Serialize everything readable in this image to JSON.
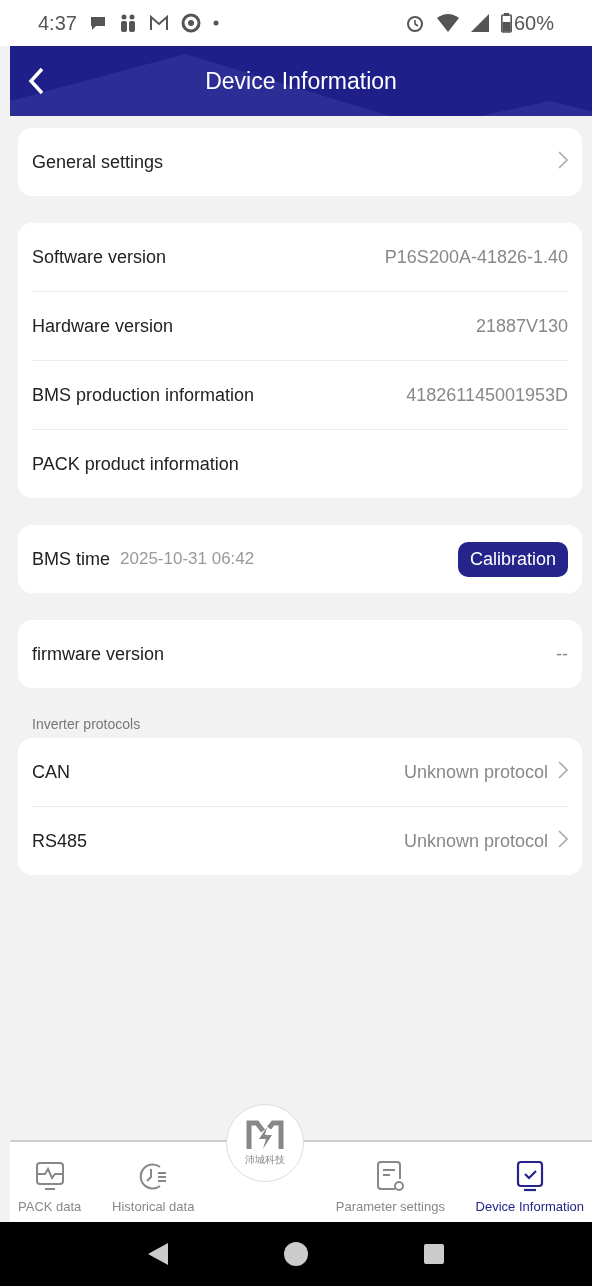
{
  "status_bar": {
    "time": "4:37",
    "battery": "60%"
  },
  "header": {
    "title": "Device Information"
  },
  "general": {
    "label": "General settings"
  },
  "versions": [
    {
      "label": "Software version",
      "value": "P16S200A-41826-1.40"
    },
    {
      "label": "Hardware version",
      "value": "21887V130"
    },
    {
      "label": "BMS production information",
      "value": "418261145001953D"
    },
    {
      "label": "PACK product information"
    }
  ],
  "bms_time": {
    "label": "BMS time",
    "value": "2025-10-31 06:42",
    "button": "Calibration"
  },
  "firmware": {
    "label": "firmware version",
    "value": "--"
  },
  "inverter": {
    "title": "Inverter protocols",
    "rows": [
      {
        "label": "CAN",
        "value": "Unknown protocol"
      },
      {
        "label": "RS485",
        "value": "Unknown protocol"
      }
    ]
  },
  "bottom_nav": {
    "logo_text": "沛城科技",
    "tabs": [
      {
        "kind": "pack",
        "label": "PACK data",
        "selected": false
      },
      {
        "kind": "history",
        "label": "Historical data",
        "selected": false
      },
      {
        "kind": "params",
        "label": "Parameter settings",
        "selected": false
      },
      {
        "kind": "device",
        "label": "Device Information",
        "selected": true
      }
    ]
  }
}
